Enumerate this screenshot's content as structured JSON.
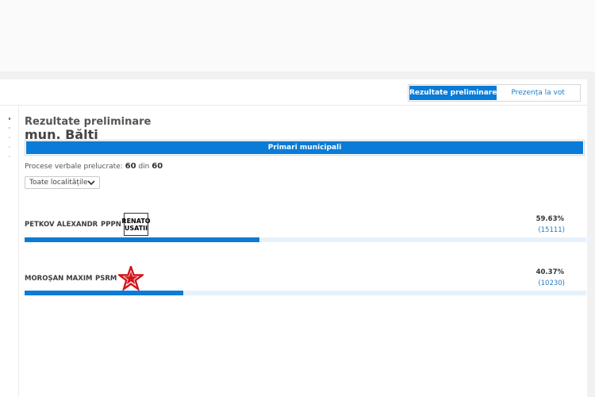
{
  "tabs": [
    {
      "label": "Rezultate preliminare",
      "active": true
    },
    {
      "label": "Prezența la vot",
      "active": false
    }
  ],
  "header": {
    "title": "Rezultate preliminare",
    "subtitle": "mun. Bălți"
  },
  "election_type": "Primari municipali",
  "processed": {
    "label": "Procese verbale prelucrate:",
    "done": "60",
    "separator": "din",
    "total": "60"
  },
  "locality_select": {
    "value": "Toate localitățile"
  },
  "candidates": [
    {
      "name": "PETKOV ALEXANDR",
      "party": "PPPN",
      "logo_text": [
        "RENATO",
        "USATII"
      ],
      "percent": "59.63%",
      "percent_value": 59.63,
      "votes": "(15111)"
    },
    {
      "name": "MOROȘAN MAXIM",
      "party": "PSRM",
      "logo": "red-star-icon",
      "percent": "40.37%",
      "percent_value": 40.37,
      "votes": "(10230)"
    }
  ],
  "colors": {
    "accent": "#0a7bd6",
    "track": "#e7f1fb",
    "link": "#2a7bbd",
    "psrm_red": "#d4141c"
  }
}
